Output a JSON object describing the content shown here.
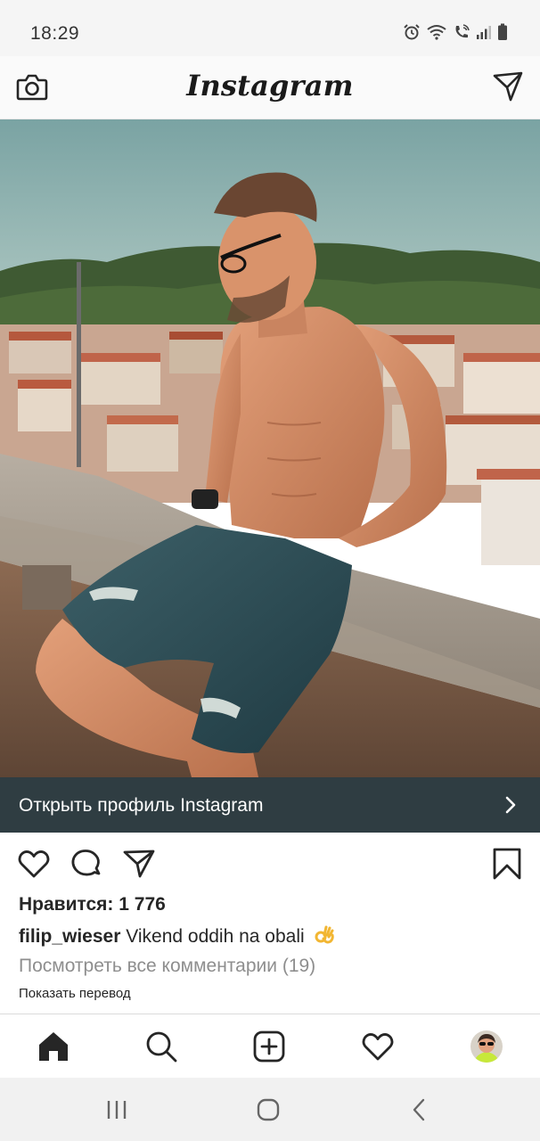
{
  "status_bar": {
    "time": "18:29",
    "icons": [
      "alarm-icon",
      "wifi-icon",
      "wifi-call-icon",
      "signal-icon",
      "battery-icon"
    ]
  },
  "app_bar": {
    "logo_text": "Instagram",
    "left_icon": "camera-icon",
    "right_icon": "direct-message-icon"
  },
  "post": {
    "photo": "shirtless-man-sitting-on-stone-wall-over-coastal-town",
    "open_profile_label": "Открыть профиль Instagram",
    "action_icons": [
      "heart-icon",
      "comment-icon",
      "share-icon",
      "bookmark-icon"
    ],
    "likes_text": "Нравится: 1 776",
    "caption_user": "filip_wieser",
    "caption_text": "Vikend oddih na obali",
    "caption_emoji": "ok-hand-emoji",
    "view_comments": "Посмотреть все комментарии (19)",
    "show_translation": "Показать перевод"
  },
  "tab_bar": {
    "items": [
      "home-icon",
      "search-icon",
      "new-post-icon",
      "activity-icon",
      "profile-avatar"
    ]
  },
  "system_nav": {
    "buttons": [
      "recent-apps-icon",
      "home-button-icon",
      "back-icon"
    ]
  },
  "colors": {
    "banner_bg": "#2f3d42",
    "muted_text": "#8e8e8e",
    "primary_text": "#262626"
  }
}
